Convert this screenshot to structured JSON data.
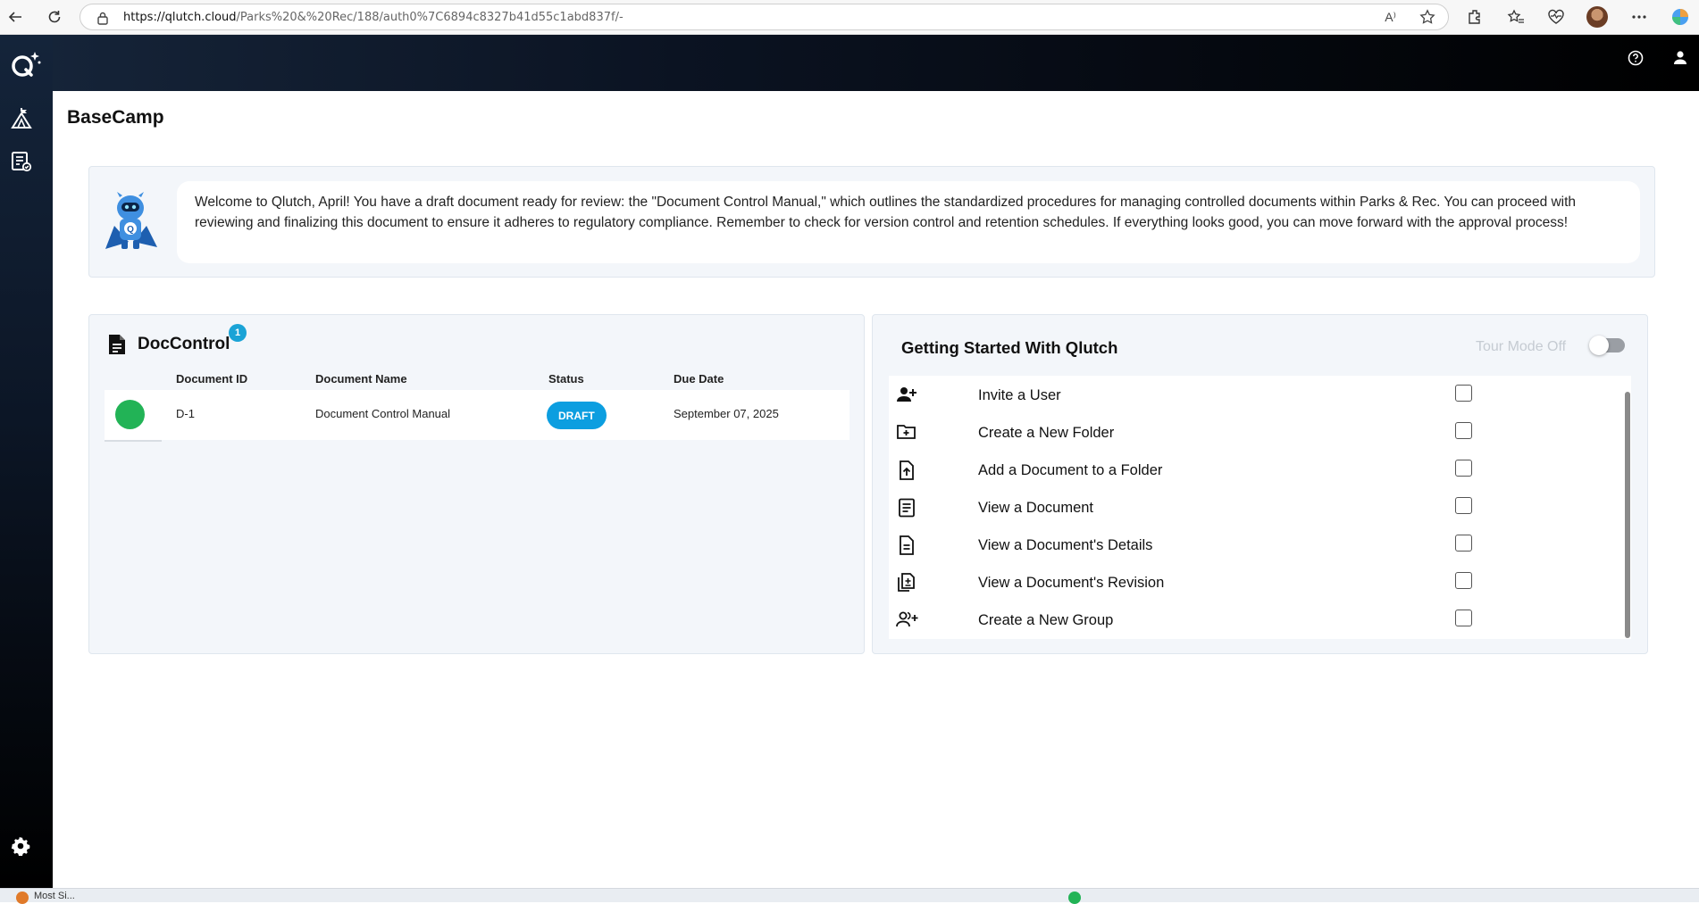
{
  "browser": {
    "url_host": "https://qlutch.cloud",
    "url_path": "/Parks%20&%20Rec/188/auth0%7C6894c8327b41d55c1abd837f/-",
    "read_aloud_label": "A⁾"
  },
  "app": {
    "page_title": "BaseCamp"
  },
  "welcome": {
    "message": "Welcome to Qlutch, April! You have a draft document ready for review: the \"Document Control Manual,\" which outlines the standardized procedures for managing controlled documents within Parks & Rec. You can proceed with reviewing and finalizing this document to ensure it adheres to regulatory compliance. Remember to check for version control and retention schedules. If everything looks good, you can move forward with the approval process!"
  },
  "doccontrol": {
    "title": "DocControl",
    "badge_count": "1",
    "columns": [
      "Document ID",
      "Document Name",
      "Status",
      "Due Date"
    ],
    "rows": [
      {
        "id": "D-1",
        "name": "Document Control Manual",
        "status": "DRAFT",
        "due": "September 07, 2025",
        "dot_color": "#22b356"
      }
    ]
  },
  "getting_started": {
    "title": "Getting Started With Qlutch",
    "tour_label": "Tour Mode Off",
    "tour_on": false,
    "items": [
      {
        "label": "Invite a User",
        "icon": "person-add-icon",
        "checked": false
      },
      {
        "label": "Create a New Folder",
        "icon": "folder-add-icon",
        "checked": false
      },
      {
        "label": "Add a Document to a Folder",
        "icon": "file-upload-icon",
        "checked": false
      },
      {
        "label": "View a Document",
        "icon": "document-lines-icon",
        "checked": false
      },
      {
        "label": "View a Document's Details",
        "icon": "document-details-icon",
        "checked": false
      },
      {
        "label": "View a Document's Revision",
        "icon": "document-revision-icon",
        "checked": false
      },
      {
        "label": "Create a New Group",
        "icon": "group-add-icon",
        "checked": false
      }
    ]
  },
  "taskbar": {
    "text": "Most Si..."
  },
  "colors": {
    "accent": "#0c9ee0",
    "badge": "#1aa3d6",
    "status_green": "#22b356"
  }
}
